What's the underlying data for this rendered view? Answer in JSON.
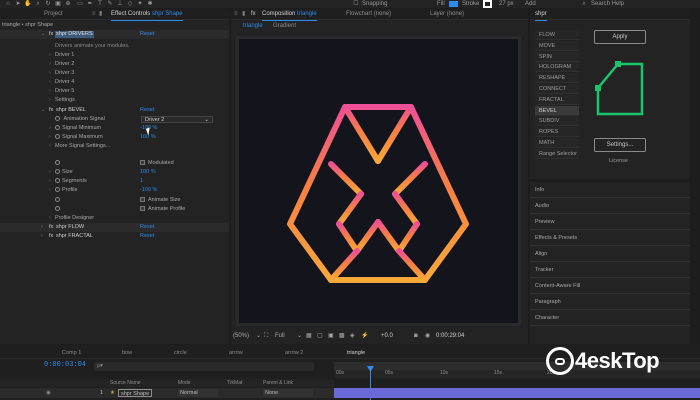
{
  "toolbar": {
    "snapping_label": "Snapping",
    "fill_label": "Fill",
    "stroke_label": "Stroke",
    "stroke_width": "27 px",
    "add_label": "Add",
    "search_help": "Search Help"
  },
  "project_tab": "Project",
  "effect_controls": {
    "tab_label": "Effect Controls",
    "layer_name": "shpr Shape",
    "layer_path": "triangle • shpr Shape",
    "drivers": {
      "name": "shpr DRIVERS",
      "reset": "Reset",
      "description": "Drivers animate your modules.",
      "items": [
        "Driver 1",
        "Driver 2",
        "Driver 3",
        "Driver 4",
        "Driver 5",
        "Settings"
      ]
    },
    "bevel": {
      "name": "shpr BEVEL",
      "reset": "Reset",
      "animation_signal_label": "Animation Signal",
      "animation_signal_value": "Driver 2",
      "signal_minimum_label": "Signal Minimum",
      "signal_minimum_value": "-100 %",
      "signal_maximum_label": "Signal Maximum",
      "signal_maximum_value": "100 %",
      "more_settings_label": "More Signal Settings...",
      "modulated_label": "Modulated",
      "size_label": "Size",
      "size_value": "100 %",
      "segments_label": "Segments",
      "segments_value": "1",
      "profile_label": "Profile",
      "profile_value": "-100 %",
      "animate_size_label": "Animate Size",
      "animate_profile_label": "Animate Profile",
      "profile_designer_label": "Profile Designer"
    },
    "flow": {
      "name": "shpr FLOW",
      "reset": "Reset"
    },
    "fractal": {
      "name": "shpr FRACTAL",
      "reset": "Reset"
    }
  },
  "composition": {
    "tab_label": "Composition",
    "comp_name": "triangle",
    "flowchart_label": "Flowchart",
    "flowchart_value": "(none)",
    "layer_label": "Layer",
    "layer_value": "(none)",
    "subtabs": [
      "triangle",
      "Gradient"
    ],
    "zoom": "(50%)",
    "resolution": "Full",
    "exposure": "+0.0",
    "timecode": "0:00:29:04"
  },
  "shpr_panel": {
    "tab_label": "shpr",
    "buttons": [
      "FLOW",
      "MOVE",
      "SPIN",
      "HOLOGRAM",
      "RESHAPE",
      "CONNECT",
      "FRACTAL",
      "BEVEL",
      "SUBDIV",
      "ROPES",
      "MATH",
      "Range Selector"
    ],
    "selected": "BEVEL",
    "apply_label": "Apply",
    "settings_label": "Settings...",
    "license_label": "License",
    "accent": "#19c46a"
  },
  "right_panels": [
    "Info",
    "Audio",
    "Preview",
    "Effects & Presets",
    "Align",
    "Tracker",
    "Content-Aware Fill",
    "Paragraph",
    "Character"
  ],
  "timeline": {
    "tabs": [
      "Comp 1",
      "bow",
      "circle",
      "arrow",
      "arrow 2",
      "triangle"
    ],
    "active_tab": "triangle",
    "timecode": "0:00:03:04",
    "search_placeholder": "ρ▾",
    "columns": [
      "Source Name",
      "Mode",
      "TrkMat",
      "Parent & Link"
    ],
    "layer": {
      "index": "1",
      "name": "shpr Shape",
      "mode": "Normal",
      "parent": "None"
    },
    "ruler": [
      "00s",
      "05s",
      "10s",
      "15s",
      "20s"
    ]
  },
  "watermark": "4eskTop",
  "logo_gradient": [
    "#ef4f96",
    "#f57f45",
    "#f9a83a"
  ]
}
